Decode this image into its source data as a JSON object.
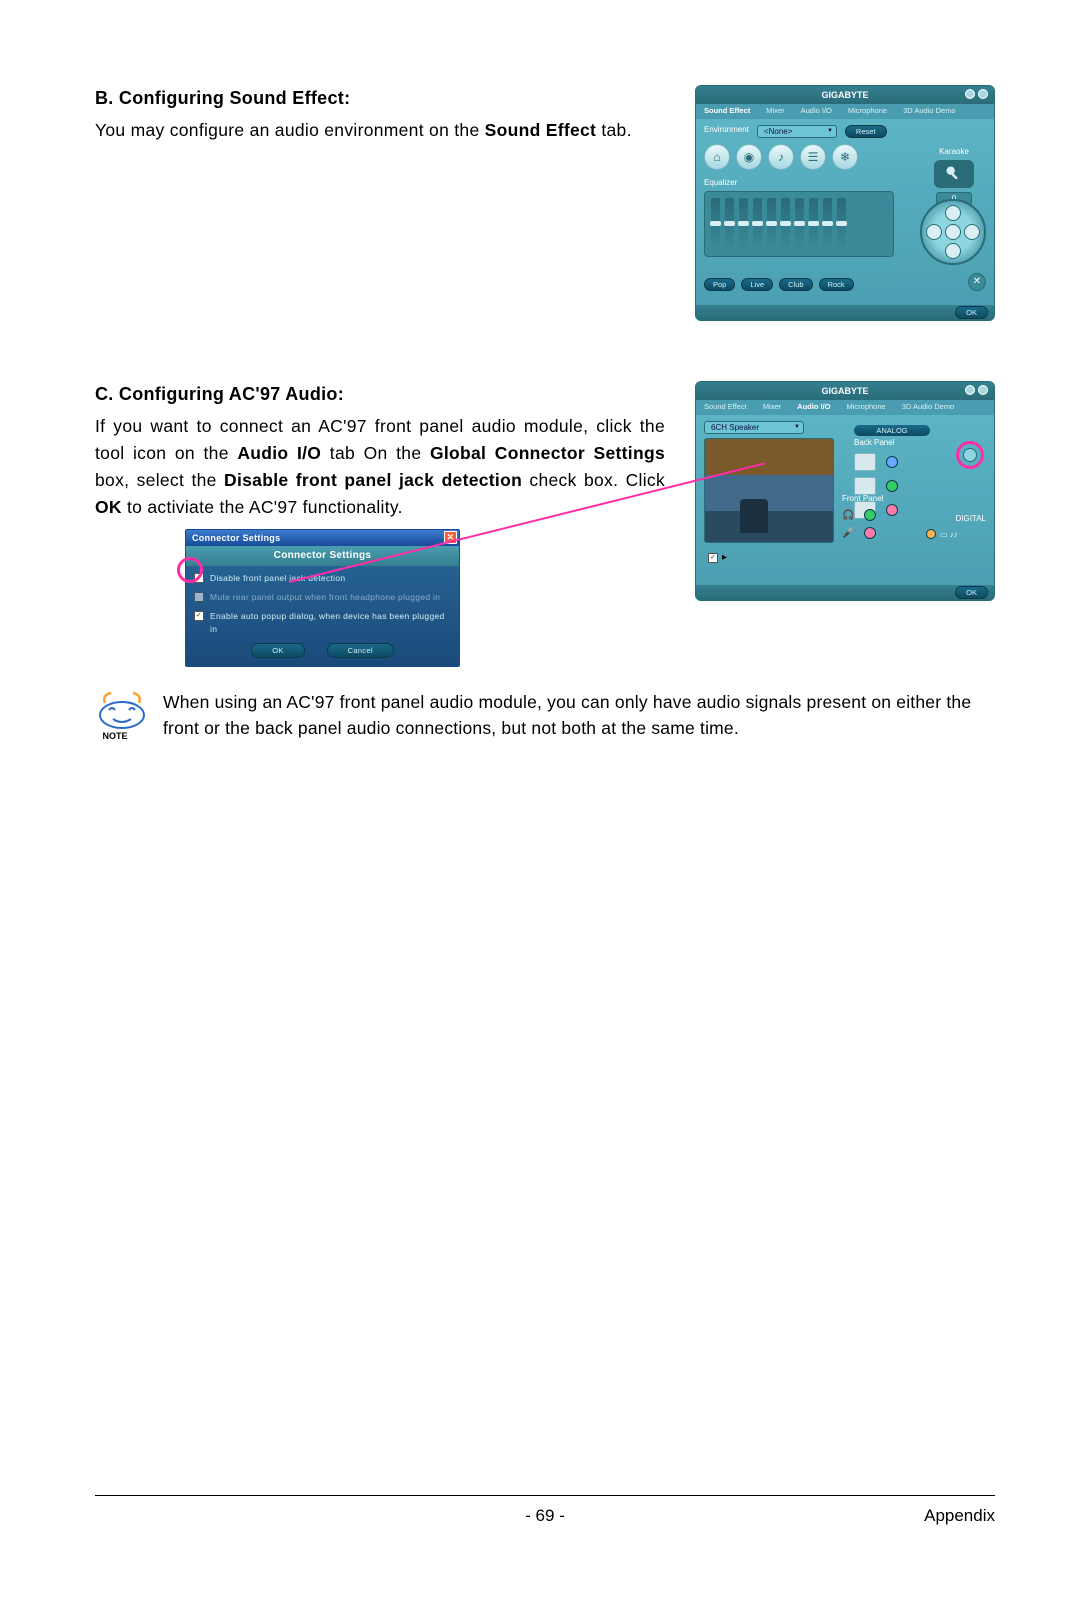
{
  "section_b": {
    "heading": "B. Configuring Sound Effect:",
    "p1_a": "You may configure an audio environment on the ",
    "p1_bold": "Sound Effect",
    "p1_b": " tab."
  },
  "section_c": {
    "heading": "C. Configuring AC'97 Audio:",
    "p1_a": "If you want to connect an AC'97 front panel audio module, click the tool icon on the ",
    "p1_bold1": "Audio I/O",
    "p1_b": " tab On the ",
    "p1_bold2": "Global Connector Settings",
    "p1_c": " box, select the ",
    "p1_bold3": "Disable front panel jack detection",
    "p1_d": " check box. Click ",
    "p1_bold4": "OK",
    "p1_e": " to activiate the AC'97 functionality."
  },
  "panel_b": {
    "brand": "GIGABYTE",
    "tabs": [
      "Sound Effect",
      "Mixer",
      "Audio I/O",
      "Microphone",
      "3D Audio Demo"
    ],
    "active_tab": 0,
    "env_label": "Environment",
    "env_value": "<None>",
    "reset": "Reset",
    "karaoke": "Karaoke",
    "karaoke_val": "0",
    "eq_label": "Equalizer",
    "presets": [
      "Pop",
      "Live",
      "Club",
      "Rock"
    ],
    "preset_extra": "Pop",
    "ok": "OK"
  },
  "panel_c": {
    "brand": "GIGABYTE",
    "tabs": [
      "Sound Effect",
      "Mixer",
      "Audio I/O",
      "Microphone",
      "3D Audio Demo"
    ],
    "active_tab": 2,
    "speaker_dd": "6CH Speaker",
    "analog": "ANALOG",
    "back_panel": "Back Panel",
    "front_panel": "Front Panel",
    "digital": "DIGITAL",
    "ok": "OK"
  },
  "dialog": {
    "title": "Connector Settings",
    "subtitle": "Connector Settings",
    "opt1": "Disable front panel jack detection",
    "opt2": "Mute rear panel output when front headphone plugged in",
    "opt3": "Enable auto popup dialog, when device has been plugged in",
    "ok": "OK",
    "cancel": "Cancel"
  },
  "note": {
    "label": "NOTE",
    "text": "When using an AC'97 front panel audio module, you can only have audio signals present on either the front or the back panel audio connections, but not both at the same time."
  },
  "footer": {
    "page": "- 69 -",
    "section": "Appendix"
  }
}
